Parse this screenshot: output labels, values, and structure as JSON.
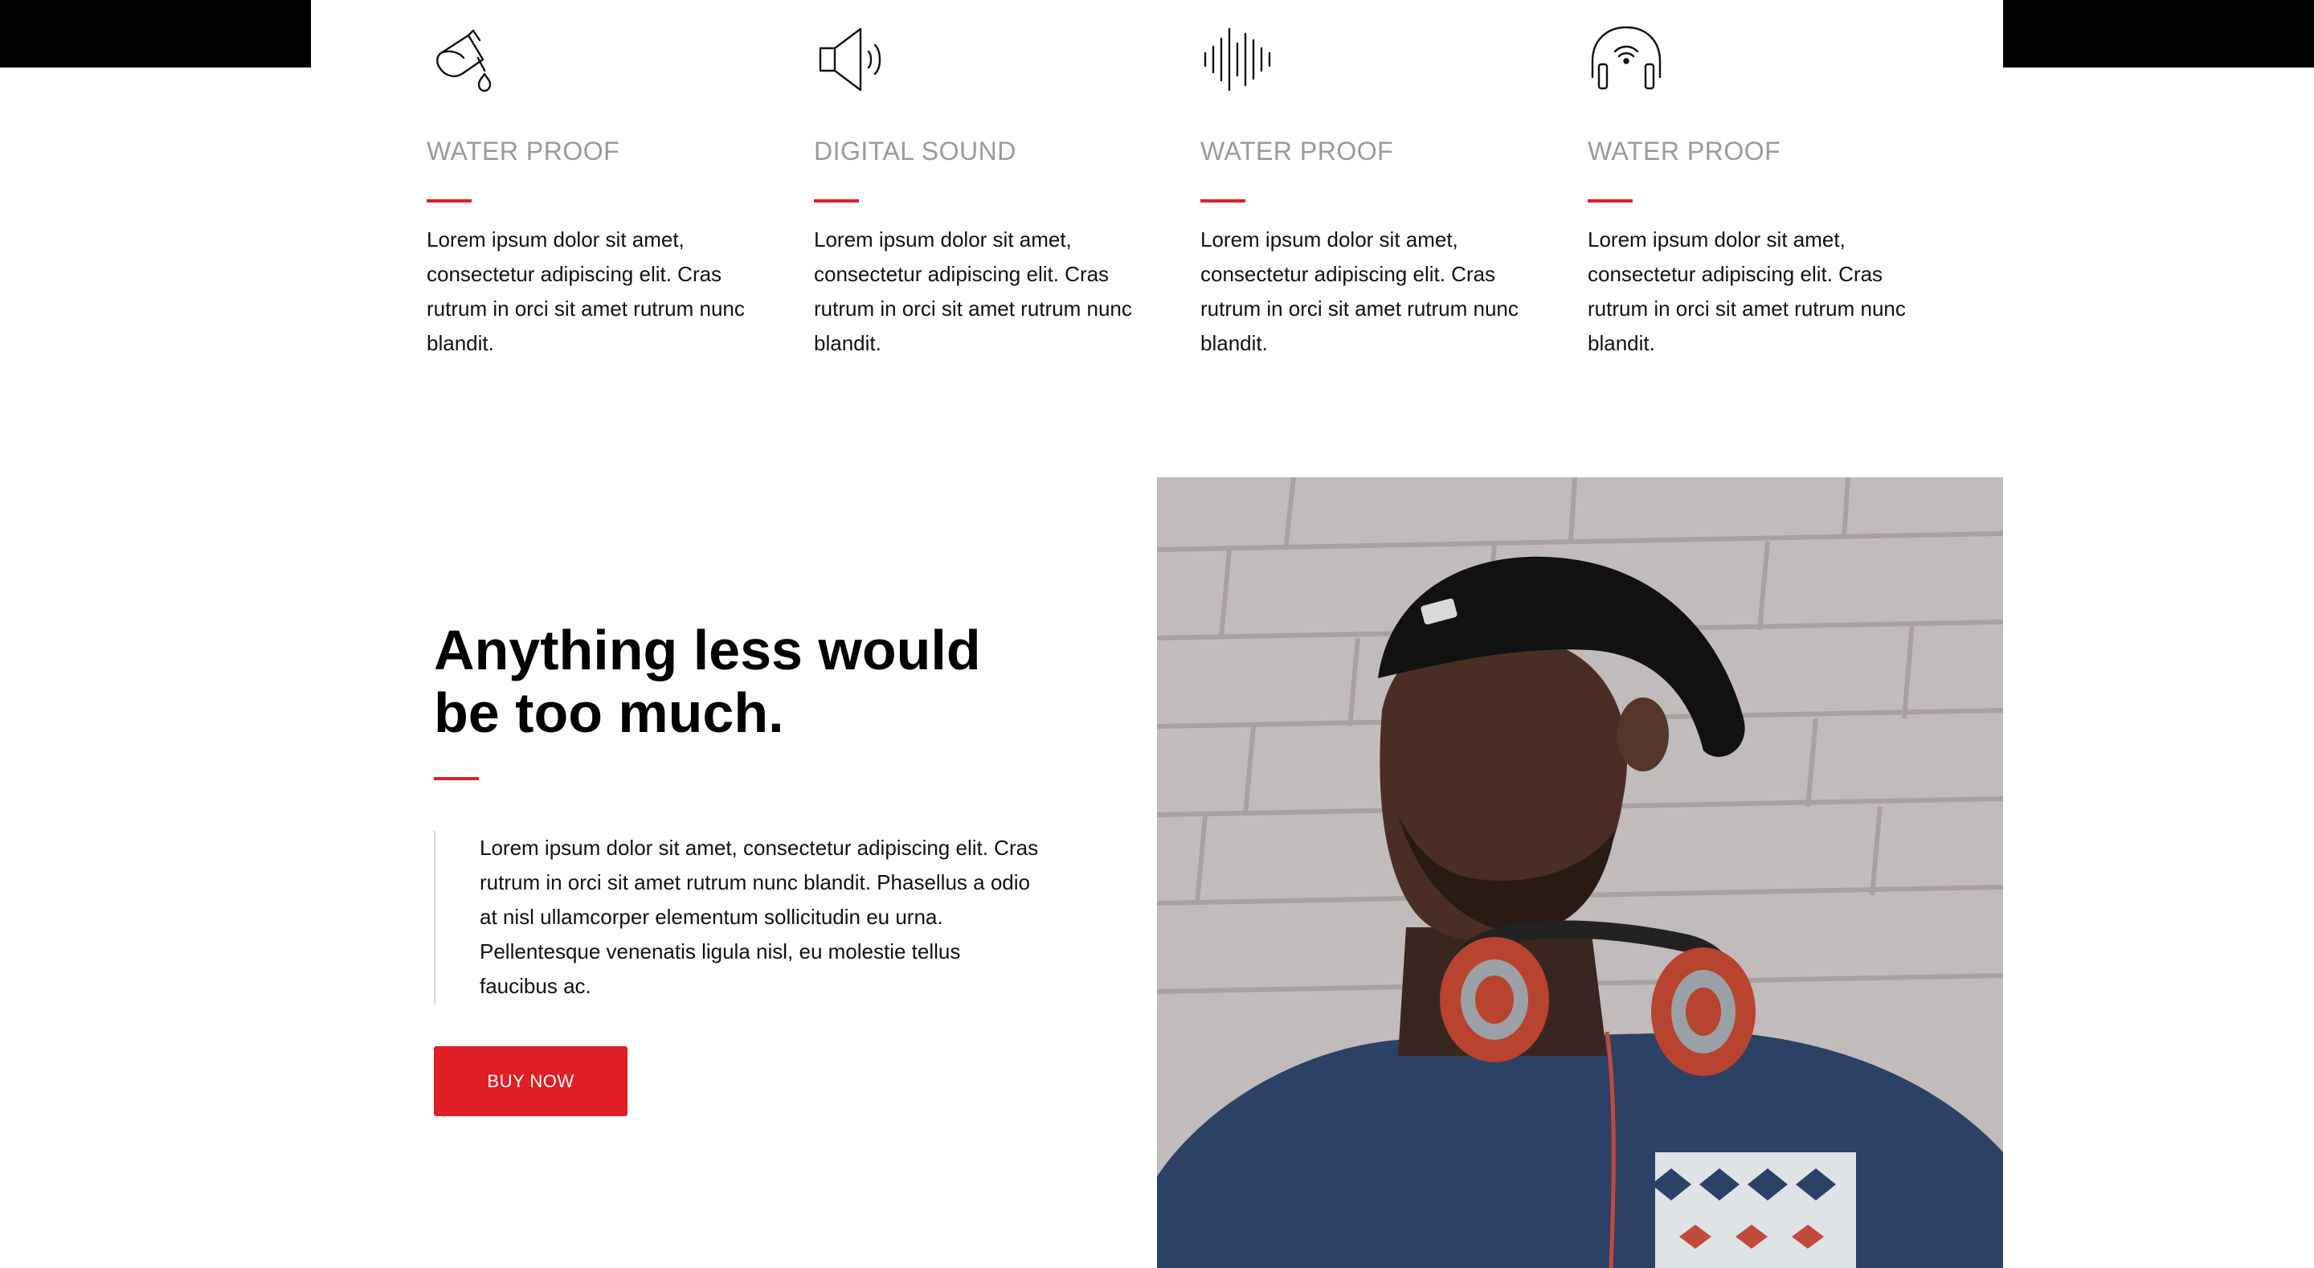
{
  "features": [
    {
      "icon": "water-pour-icon",
      "title": "WATER PROOF",
      "description": "Lorem ipsum dolor sit amet, consectetur adipiscing elit. Cras rutrum in orci sit amet rutrum nunc blandit."
    },
    {
      "icon": "speaker-icon",
      "title": "DIGITAL SOUND",
      "description": "Lorem ipsum dolor sit amet, consectetur adipiscing elit. Cras rutrum in orci sit amet rutrum nunc blandit."
    },
    {
      "icon": "sound-wave-icon",
      "title": "WATER PROOF",
      "description": "Lorem ipsum dolor sit amet, consectetur adipiscing elit. Cras rutrum in orci sit amet rutrum nunc blandit."
    },
    {
      "icon": "wireless-headphones-icon",
      "title": "WATER PROOF",
      "description": "Lorem ipsum dolor sit amet, consectetur adipiscing elit. Cras rutrum in orci sit amet rutrum nunc blandit."
    }
  ],
  "promo": {
    "headline": "Anything less would be too much.",
    "quote": "Lorem ipsum dolor sit amet, consectetur adipiscing elit. Cras rutrum in orci sit amet rutrum nunc blandit. Phasellus a odio at nisl ullamcorper elementum sollicitudin eu urna. Pellentesque venenatis ligula nisl, eu molestie tellus faucibus ac.",
    "button_label": "BUY NOW"
  },
  "colors": {
    "accent": "#e01e26",
    "title_gray": "#9a9a9a",
    "text": "#111111",
    "bar": "#000000"
  }
}
